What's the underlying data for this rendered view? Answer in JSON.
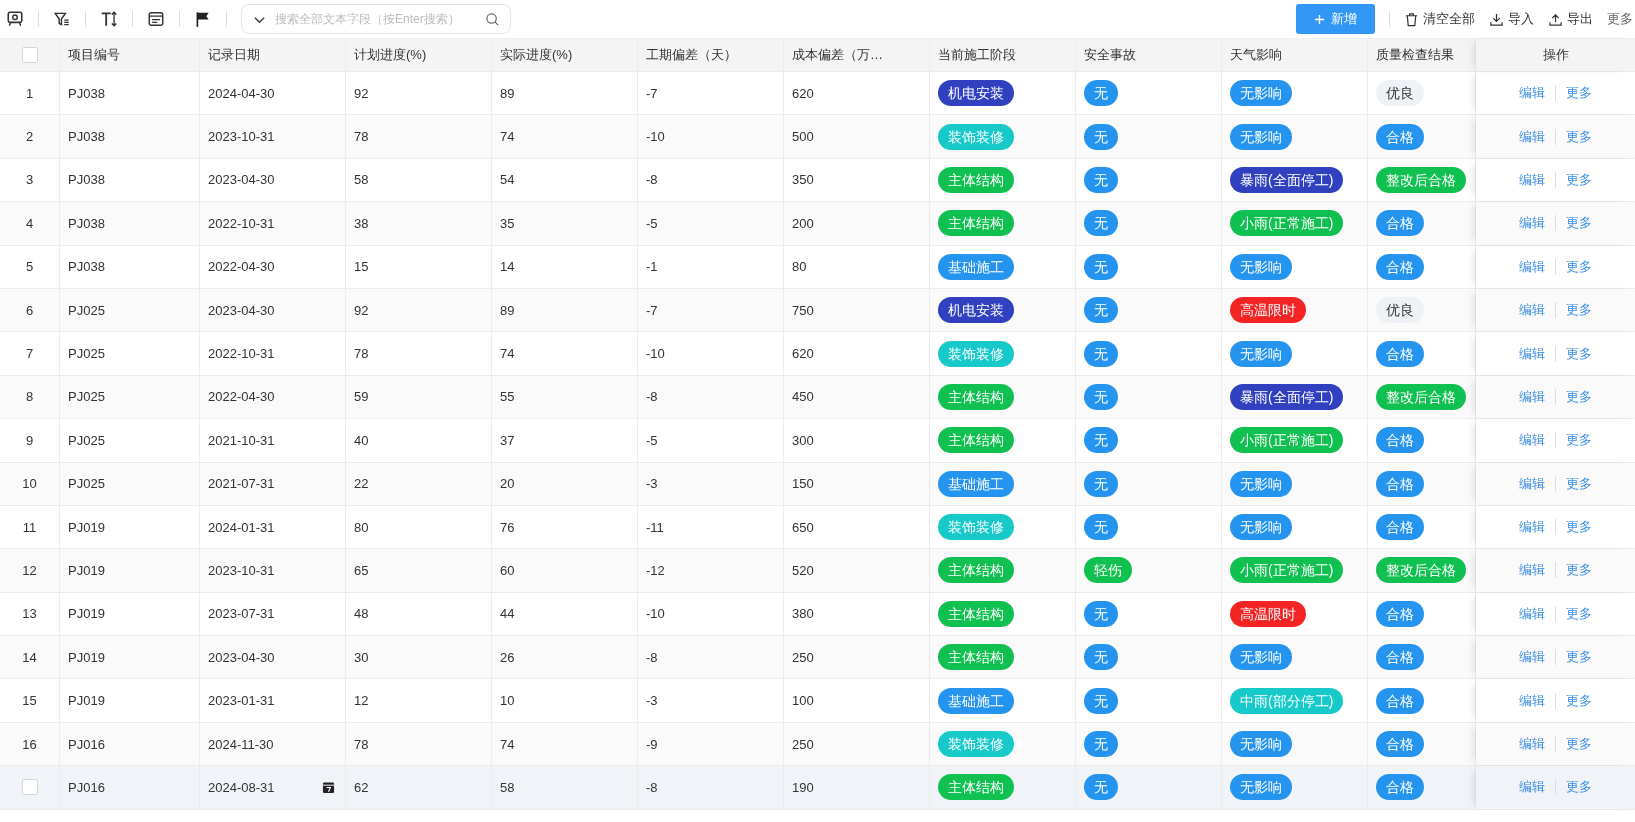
{
  "toolbar": {
    "search": {
      "placeholder": "搜索全部文本字段（按Enter搜索）"
    },
    "add_button": "新增",
    "actions": [
      "清空全部",
      "导入",
      "导出"
    ],
    "more": "更多"
  },
  "table": {
    "select_all": {
      "checked": false
    },
    "columns": [
      "项目编号",
      "记录日期",
      "计划进度(%)",
      "实际进度(%)",
      "工期偏差（天）",
      "成本偏差（万…",
      "当前施工阶段",
      "安全事故",
      "天气影响",
      "质量检查结果",
      "操作"
    ],
    "rows": [
      {
        "no": "1",
        "project": "PJ038",
        "date": "2024-04-30",
        "plan": "92",
        "actual": "89",
        "delay": "-7",
        "cost": "620",
        "stage": {
          "text": "机电安装",
          "color": "#3040bf"
        },
        "safety": {
          "text": "无",
          "color": "#2594ee"
        },
        "weather": {
          "text": "无影响",
          "color": "#2594ee"
        },
        "quality": {
          "text": "优良",
          "color": "#eef2f6"
        },
        "actions": [
          "编辑",
          "更多"
        ],
        "hovered": false
      },
      {
        "no": "2",
        "project": "PJ038",
        "date": "2023-10-31",
        "plan": "78",
        "actual": "74",
        "delay": "-10",
        "cost": "500",
        "stage": {
          "text": "装饰装修",
          "color": "#17c9c9"
        },
        "safety": {
          "text": "无",
          "color": "#2594ee"
        },
        "weather": {
          "text": "无影响",
          "color": "#2594ee"
        },
        "quality": {
          "text": "合格",
          "color": "#2594ee"
        },
        "actions": [
          "编辑",
          "更多"
        ],
        "hovered": false
      },
      {
        "no": "3",
        "project": "PJ038",
        "date": "2023-04-30",
        "plan": "58",
        "actual": "54",
        "delay": "-8",
        "cost": "350",
        "stage": {
          "text": "主体结构",
          "color": "#10c050"
        },
        "safety": {
          "text": "无",
          "color": "#2594ee"
        },
        "weather": {
          "text": "暴雨(全面停工)",
          "color": "#3040bf"
        },
        "quality": {
          "text": "整改后合格",
          "color": "#10c050"
        },
        "actions": [
          "编辑",
          "更多"
        ],
        "hovered": false
      },
      {
        "no": "4",
        "project": "PJ038",
        "date": "2022-10-31",
        "plan": "38",
        "actual": "35",
        "delay": "-5",
        "cost": "200",
        "stage": {
          "text": "主体结构",
          "color": "#10c050"
        },
        "safety": {
          "text": "无",
          "color": "#2594ee"
        },
        "weather": {
          "text": "小雨(正常施工)",
          "color": "#10c050"
        },
        "quality": {
          "text": "合格",
          "color": "#2594ee"
        },
        "actions": [
          "编辑",
          "更多"
        ],
        "hovered": false
      },
      {
        "no": "5",
        "project": "PJ038",
        "date": "2022-04-30",
        "plan": "15",
        "actual": "14",
        "delay": "-1",
        "cost": "80",
        "stage": {
          "text": "基础施工",
          "color": "#2594ee"
        },
        "safety": {
          "text": "无",
          "color": "#2594ee"
        },
        "weather": {
          "text": "无影响",
          "color": "#2594ee"
        },
        "quality": {
          "text": "合格",
          "color": "#2594ee"
        },
        "actions": [
          "编辑",
          "更多"
        ],
        "hovered": false
      },
      {
        "no": "6",
        "project": "PJ025",
        "date": "2023-04-30",
        "plan": "92",
        "actual": "89",
        "delay": "-7",
        "cost": "750",
        "stage": {
          "text": "机电安装",
          "color": "#3040bf"
        },
        "safety": {
          "text": "无",
          "color": "#2594ee"
        },
        "weather": {
          "text": "高温限时",
          "color": "#f52424"
        },
        "quality": {
          "text": "优良",
          "color": "#eef2f6"
        },
        "actions": [
          "编辑",
          "更多"
        ],
        "hovered": false
      },
      {
        "no": "7",
        "project": "PJ025",
        "date": "2022-10-31",
        "plan": "78",
        "actual": "74",
        "delay": "-10",
        "cost": "620",
        "stage": {
          "text": "装饰装修",
          "color": "#17c9c9"
        },
        "safety": {
          "text": "无",
          "color": "#2594ee"
        },
        "weather": {
          "text": "无影响",
          "color": "#2594ee"
        },
        "quality": {
          "text": "合格",
          "color": "#2594ee"
        },
        "actions": [
          "编辑",
          "更多"
        ],
        "hovered": false
      },
      {
        "no": "8",
        "project": "PJ025",
        "date": "2022-04-30",
        "plan": "59",
        "actual": "55",
        "delay": "-8",
        "cost": "450",
        "stage": {
          "text": "主体结构",
          "color": "#10c050"
        },
        "safety": {
          "text": "无",
          "color": "#2594ee"
        },
        "weather": {
          "text": "暴雨(全面停工)",
          "color": "#3040bf"
        },
        "quality": {
          "text": "整改后合格",
          "color": "#10c050"
        },
        "actions": [
          "编辑",
          "更多"
        ],
        "hovered": false
      },
      {
        "no": "9",
        "project": "PJ025",
        "date": "2021-10-31",
        "plan": "40",
        "actual": "37",
        "delay": "-5",
        "cost": "300",
        "stage": {
          "text": "主体结构",
          "color": "#10c050"
        },
        "safety": {
          "text": "无",
          "color": "#2594ee"
        },
        "weather": {
          "text": "小雨(正常施工)",
          "color": "#10c050"
        },
        "quality": {
          "text": "合格",
          "color": "#2594ee"
        },
        "actions": [
          "编辑",
          "更多"
        ],
        "hovered": false
      },
      {
        "no": "10",
        "project": "PJ025",
        "date": "2021-07-31",
        "plan": "22",
        "actual": "20",
        "delay": "-3",
        "cost": "150",
        "stage": {
          "text": "基础施工",
          "color": "#2594ee"
        },
        "safety": {
          "text": "无",
          "color": "#2594ee"
        },
        "weather": {
          "text": "无影响",
          "color": "#2594ee"
        },
        "quality": {
          "text": "合格",
          "color": "#2594ee"
        },
        "actions": [
          "编辑",
          "更多"
        ],
        "hovered": false
      },
      {
        "no": "11",
        "project": "PJ019",
        "date": "2024-01-31",
        "plan": "80",
        "actual": "76",
        "delay": "-11",
        "cost": "650",
        "stage": {
          "text": "装饰装修",
          "color": "#17c9c9"
        },
        "safety": {
          "text": "无",
          "color": "#2594ee"
        },
        "weather": {
          "text": "无影响",
          "color": "#2594ee"
        },
        "quality": {
          "text": "合格",
          "color": "#2594ee"
        },
        "actions": [
          "编辑",
          "更多"
        ],
        "hovered": false
      },
      {
        "no": "12",
        "project": "PJ019",
        "date": "2023-10-31",
        "plan": "65",
        "actual": "60",
        "delay": "-12",
        "cost": "520",
        "stage": {
          "text": "主体结构",
          "color": "#10c050"
        },
        "safety": {
          "text": "轻伤",
          "color": "#10c050"
        },
        "weather": {
          "text": "小雨(正常施工)",
          "color": "#10c050"
        },
        "quality": {
          "text": "整改后合格",
          "color": "#10c050"
        },
        "actions": [
          "编辑",
          "更多"
        ],
        "hovered": false
      },
      {
        "no": "13",
        "project": "PJ019",
        "date": "2023-07-31",
        "plan": "48",
        "actual": "44",
        "delay": "-10",
        "cost": "380",
        "stage": {
          "text": "主体结构",
          "color": "#10c050"
        },
        "safety": {
          "text": "无",
          "color": "#2594ee"
        },
        "weather": {
          "text": "高温限时",
          "color": "#f52424"
        },
        "quality": {
          "text": "合格",
          "color": "#2594ee"
        },
        "actions": [
          "编辑",
          "更多"
        ],
        "hovered": false
      },
      {
        "no": "14",
        "project": "PJ019",
        "date": "2023-04-30",
        "plan": "30",
        "actual": "26",
        "delay": "-8",
        "cost": "250",
        "stage": {
          "text": "主体结构",
          "color": "#10c050"
        },
        "safety": {
          "text": "无",
          "color": "#2594ee"
        },
        "weather": {
          "text": "无影响",
          "color": "#2594ee"
        },
        "quality": {
          "text": "合格",
          "color": "#2594ee"
        },
        "actions": [
          "编辑",
          "更多"
        ],
        "hovered": false
      },
      {
        "no": "15",
        "project": "PJ019",
        "date": "2023-01-31",
        "plan": "12",
        "actual": "10",
        "delay": "-3",
        "cost": "100",
        "stage": {
          "text": "基础施工",
          "color": "#2594ee"
        },
        "safety": {
          "text": "无",
          "color": "#2594ee"
        },
        "weather": {
          "text": "中雨(部分停工)",
          "color": "#17c9c9"
        },
        "quality": {
          "text": "合格",
          "color": "#2594ee"
        },
        "actions": [
          "编辑",
          "更多"
        ],
        "hovered": false
      },
      {
        "no": "16",
        "project": "PJ016",
        "date": "2024-11-30",
        "plan": "78",
        "actual": "74",
        "delay": "-9",
        "cost": "250",
        "stage": {
          "text": "装饰装修",
          "color": "#17c9c9"
        },
        "safety": {
          "text": "无",
          "color": "#2594ee"
        },
        "weather": {
          "text": "无影响",
          "color": "#2594ee"
        },
        "quality": {
          "text": "合格",
          "color": "#2594ee"
        },
        "actions": [
          "编辑",
          "更多"
        ],
        "hovered": false
      },
      {
        "project": "PJ016",
        "date": "2024-08-31",
        "plan": "62",
        "actual": "58",
        "delay": "-8",
        "cost": "190",
        "stage": {
          "text": "主体结构",
          "color": "#10c050"
        },
        "safety": {
          "text": "无",
          "color": "#2594ee"
        },
        "weather": {
          "text": "无影响",
          "color": "#2594ee"
        },
        "quality": {
          "text": "合格",
          "color": "#2594ee"
        },
        "actions": [
          "编辑",
          "更多"
        ],
        "hovered": true,
        "checked": false
      }
    ]
  }
}
